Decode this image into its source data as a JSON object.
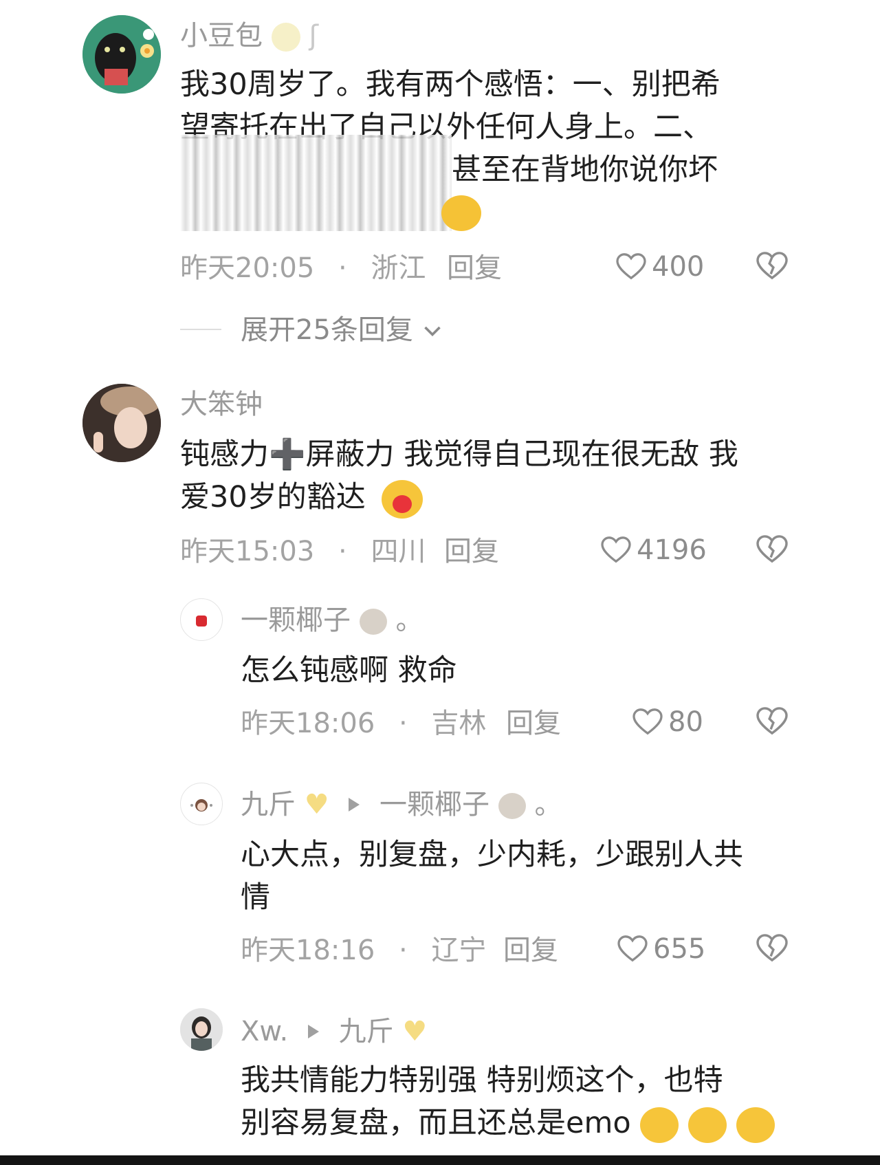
{
  "comments": [
    {
      "username": "小豆包",
      "text_line1": "我30周岁了。我有两个感悟：一、别把希",
      "text_line2": "望寄托在出了自己以外任何人身上。二、",
      "text_line3": "甚至在背地你说你坏",
      "time": "昨天20:05",
      "location": "浙江",
      "reply_label": "回复",
      "likes": "400",
      "expand_label": "展开25条回复"
    },
    {
      "username": "大笨钟",
      "text_line1": "钝感力➕屏蔽力 我觉得自己现在很无敌 我",
      "text_line2": "爱30岁的豁达",
      "time": "昨天15:03",
      "location": "四川",
      "reply_label": "回复",
      "likes": "4196"
    }
  ],
  "replies": [
    {
      "username": "一颗椰子",
      "username_suffix": "。",
      "text": "怎么钝感啊 救命",
      "time": "昨天18:06",
      "location": "吉林",
      "reply_label": "回复",
      "likes": "80"
    },
    {
      "username": "九斤",
      "reply_to": "一颗椰子",
      "reply_to_suffix": "。",
      "text_line1": "心大点，别复盘，少内耗，少跟别人共",
      "text_line2": "情",
      "time": "昨天18:16",
      "location": "辽宁",
      "reply_label": "回复",
      "likes": "655"
    },
    {
      "username": "Xw.",
      "reply_to": "九斤",
      "text_line1": "我共情能力特别强 特别烦这个，也特",
      "text_line2": "别容易复盘，而且还总是emo"
    }
  ],
  "separator": "·",
  "icons": [
    "heart-icon",
    "dislike-icon",
    "chevron-down-icon",
    "triangle-arrow-icon",
    "coconut-emoji",
    "yellow-heart-emoji",
    "crying-emoji",
    "hug-emoji",
    "grin-emoji"
  ]
}
